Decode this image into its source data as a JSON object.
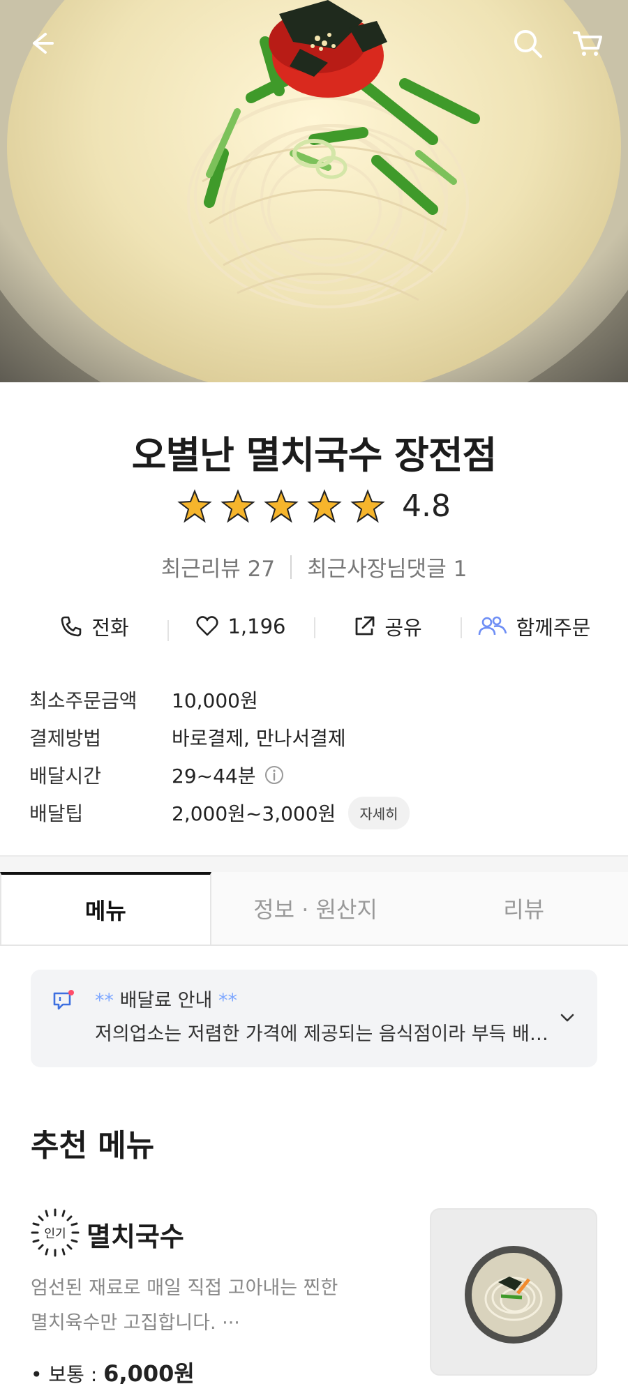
{
  "store": {
    "name": "오별난 멸치국수 장전점",
    "rating": "4.8",
    "rating_stars": 5,
    "recent_reviews": "최근리뷰 27",
    "recent_owner_comments": "최근사장님댓글 1"
  },
  "actions": {
    "call": "전화",
    "like_count": "1,196",
    "share": "공유",
    "group_order": "함께주문"
  },
  "info": {
    "min_order": {
      "label": "최소주문금액",
      "value": "10,000원"
    },
    "payment": {
      "label": "결제방법",
      "value": "바로결제, 만나서결제"
    },
    "delivery_time": {
      "label": "배달시간",
      "value": "29~44분"
    },
    "delivery_tip": {
      "label": "배달팁",
      "value": "2,000원~3,000원",
      "detail_button": "자세히"
    }
  },
  "tabs": {
    "menu": "메뉴",
    "info_origin": "정보 · 원산지",
    "review": "리뷰"
  },
  "notice": {
    "stars_left": "**",
    "title": " 배달료 안내 ",
    "stars_right": "**",
    "text": "저의업소는 저렴한 가격에 제공되는 음식점이라 부득 배달료가 발생함을 양해 부탁드립니다"
  },
  "recommended": {
    "title": "추천 메뉴",
    "item": {
      "badge": "인기",
      "name": "멸치국수",
      "description": "엄선된 재료로 매일 직접 고아내는 찐한 멸치육수만 고집합니다. ···",
      "price_label": "• 보통 : ",
      "price": "6,000원"
    }
  },
  "colors": {
    "star": "#F6B52C",
    "accent_blue": "#6E8EF5",
    "notice_bg": "#F3F4F6"
  },
  "icons": [
    "back-arrow-icon",
    "search-icon",
    "cart-icon",
    "star-icon",
    "phone-icon",
    "heart-icon",
    "share-icon",
    "group-icon",
    "info-icon",
    "chat-icon",
    "chevron-down-icon",
    "popular-badge-icon"
  ]
}
